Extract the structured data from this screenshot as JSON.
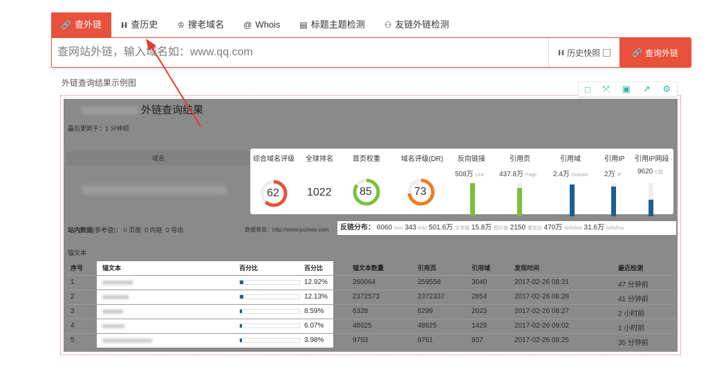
{
  "tabs": [
    {
      "icon": "link-icon",
      "glyph": "🔗",
      "label": "查外链",
      "active": true
    },
    {
      "icon": "history-icon",
      "glyph": "H",
      "label": "查历史",
      "active": false
    },
    {
      "icon": "trophy-icon",
      "glyph": "♔",
      "label": "搜老域名",
      "active": false
    },
    {
      "icon": "at-icon",
      "glyph": "@",
      "label": "Whois",
      "active": false
    },
    {
      "icon": "document-icon",
      "glyph": "▤",
      "label": "标题主题检测",
      "active": false
    },
    {
      "icon": "friend-links-icon",
      "glyph": "⚇",
      "label": "友链外链检测",
      "active": false
    }
  ],
  "search": {
    "placeholder": "查网站外链，输入域名如：www.qq.com",
    "history_label": "历史快照",
    "history_icon_text": "H",
    "query_button": "查询外链",
    "query_icon": "🔗"
  },
  "caption": "外链查询结果示例图",
  "toolbar": [
    "□",
    "⤧",
    "▣",
    "↗",
    "⚙"
  ],
  "result": {
    "title_suffix": "外链查询结果",
    "updated": "最后更新于：1 分钟前",
    "domain_header": "域名"
  },
  "metrics": {
    "headers": [
      "综合域名评级",
      "全球排名",
      "首页权重",
      "域名评级(DR)",
      "反向链接",
      "引用页",
      "引用域",
      "引用IP",
      "引用IP网段"
    ],
    "score": 62,
    "global_rank": "1022",
    "home_weight": 85,
    "dr": 73,
    "backlinks": {
      "value": "508万",
      "unit": "Link"
    },
    "ref_pages": {
      "value": "437.8万",
      "unit": "Page"
    },
    "ref_domains": {
      "value": "2.4万",
      "unit": "Domain"
    },
    "ref_ips": {
      "value": "2万",
      "unit": "IP"
    },
    "ref_ip_subnets": {
      "value": "9620",
      "unit": "C段"
    },
    "bar_levels": [
      1.0,
      0.86,
      0.95,
      0.9,
      0.5
    ],
    "colors": {
      "score": "#e8513b",
      "weight": "#7cbf3d",
      "dr": "#f07e1b",
      "green": "#7cbf3d",
      "blue": "#1d5e95"
    }
  },
  "site_stats": {
    "label": "站内数据",
    "sub": "(参考值)：",
    "pages": "0",
    "pages_unit": "页面",
    "inlinks": "0",
    "inlinks_unit": "内链",
    "outlinks": "0",
    "outlinks_unit": "导出"
  },
  "source": "数据来自：http://www.juziseo.com",
  "distribution": {
    "label": "反链分布：",
    "items": [
      {
        "value": "6060",
        "unit": "Gov"
      },
      {
        "value": "343",
        "unit": "Edu"
      },
      {
        "value": "501.6万",
        "unit": "文字链"
      },
      {
        "value": "15.8万",
        "unit": "图片链"
      },
      {
        "value": "2150",
        "unit": "重定向"
      },
      {
        "value": "470万",
        "unit": "dofollow"
      },
      {
        "value": "31.6万",
        "unit": "nofollow"
      }
    ]
  },
  "anchor_section": "锚文本",
  "table": {
    "headers": [
      "序号",
      "锚文本",
      "百分比",
      "百分比",
      "锚文本数量",
      "引用页",
      "引用域",
      "发现时间",
      "最近检测"
    ],
    "rows": [
      {
        "no": "1",
        "pct": "12.92%",
        "pct_value": 0.1292,
        "count": "260064",
        "pages": "259558",
        "domains": "3040",
        "found": "2017-02-26 08:31",
        "checked": "47 分钟前"
      },
      {
        "no": "2",
        "pct": "12.13%",
        "pct_value": 0.1213,
        "count": "2372573",
        "pages": "2372337",
        "domains": "2854",
        "found": "2017-02-26 08:28",
        "checked": "41 分钟前"
      },
      {
        "no": "3",
        "pct": "8.59%",
        "pct_value": 0.0859,
        "count": "6328",
        "pages": "6299",
        "domains": "2023",
        "found": "2017-02-26 08:27",
        "checked": "2 小时前"
      },
      {
        "no": "4",
        "pct": "6.07%",
        "pct_value": 0.0607,
        "count": "48625",
        "pages": "48625",
        "domains": "1429",
        "found": "2017-02-26 09:02",
        "checked": "1 小时前"
      },
      {
        "no": "5",
        "pct": "3.98%",
        "pct_value": 0.0398,
        "count": "9793",
        "pages": "9761",
        "domains": "937",
        "found": "2017-02-26 08:25",
        "checked": "35 分钟前"
      }
    ]
  }
}
